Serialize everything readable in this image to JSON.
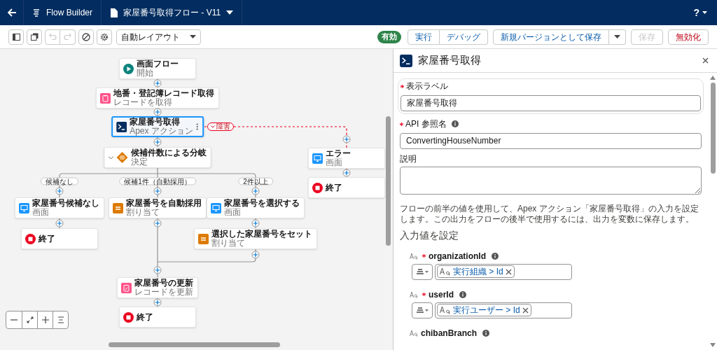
{
  "header": {
    "app_name": "Flow Builder",
    "flow_title": "家屋番号取得フロー - V11",
    "help_label": "?"
  },
  "toolbar": {
    "tools": [
      {
        "kind": "sidebar",
        "disabled": false
      },
      {
        "kind": "copy",
        "disabled": false
      },
      {
        "kind": "undo",
        "disabled": true
      },
      {
        "kind": "redo",
        "disabled": true
      },
      {
        "kind": "clear",
        "disabled": false
      },
      {
        "kind": "settings",
        "disabled": false
      }
    ],
    "layout_mode": "自動レイアウト",
    "status_badge": "有効",
    "actions": [
      {
        "label": "実行",
        "kind": "group",
        "disabled": false
      },
      {
        "label": "デバッグ",
        "kind": "group",
        "disabled": false
      },
      {
        "label": "新規バージョンとして保存",
        "kind": "split",
        "disabled": false
      },
      {
        "label": "保存",
        "kind": "plain",
        "disabled": true
      },
      {
        "label": "無効化",
        "kind": "destructive",
        "disabled": false
      }
    ]
  },
  "canvas": {
    "nodes": [
      {
        "kind": "start",
        "title": "画面フロー",
        "subtitle": "開始",
        "selected": false
      },
      {
        "kind": "get",
        "title": "地番・登記簿レコード取得",
        "subtitle": "レコードを取得",
        "selected": false
      },
      {
        "kind": "apex",
        "title": "家屋番号取得",
        "subtitle": "Apex アクション",
        "selected": true
      },
      {
        "kind": "decision",
        "title": "候補件数による分岐",
        "subtitle": "決定",
        "selected": false
      },
      {
        "kind": "screen",
        "title": "家屋番号候補なし",
        "subtitle": "画面",
        "selected": false
      },
      {
        "kind": "assignment",
        "title": "家屋番号を自動採用",
        "subtitle": "割り当て",
        "selected": false
      },
      {
        "kind": "screen",
        "title": "家屋番号を選択する",
        "subtitle": "画面",
        "selected": false
      },
      {
        "kind": "end",
        "title": "終了",
        "selected": false
      },
      {
        "kind": "assignment",
        "title": "選択した家屋番号をセット",
        "subtitle": "割り当て",
        "selected": false
      },
      {
        "kind": "update",
        "title": "家屋番号の更新",
        "subtitle": "レコードを更新",
        "selected": false
      },
      {
        "kind": "end",
        "title": "終了",
        "selected": false
      },
      {
        "kind": "screen",
        "title": "エラー",
        "subtitle": "画面",
        "selected": false
      },
      {
        "kind": "end",
        "title": "終了",
        "selected": false
      }
    ],
    "branch_labels": [
      "候補なし",
      "候補1件（自動採用）",
      "2件以上"
    ],
    "fault_label": "障害"
  },
  "panel": {
    "title": "家屋番号取得",
    "fields": [
      {
        "kind": "text",
        "label": "表示ラベル",
        "required": true,
        "info": false,
        "focused": true,
        "value": "家屋番号取得"
      },
      {
        "kind": "text",
        "label": "API 参照名",
        "required": true,
        "info": true,
        "focused": false,
        "value": "ConvertingHouseNumber"
      },
      {
        "kind": "textarea",
        "label": "説明",
        "required": false,
        "info": false,
        "focused": false
      }
    ],
    "description": "フローの前半の値を使用して、Apex アクション「家屋番号取得」の入力を設定します。この出力をフローの後半で使用するには、出力を変数に保存します。",
    "section_title": "入力値を設定",
    "inputs": [
      {
        "name": "organizationId",
        "required": true,
        "value": "実行組織 > Id"
      },
      {
        "name": "userId",
        "required": true,
        "value": "実行ユーザー > Id"
      },
      {
        "name": "chibanBranch",
        "required": false
      }
    ]
  }
}
